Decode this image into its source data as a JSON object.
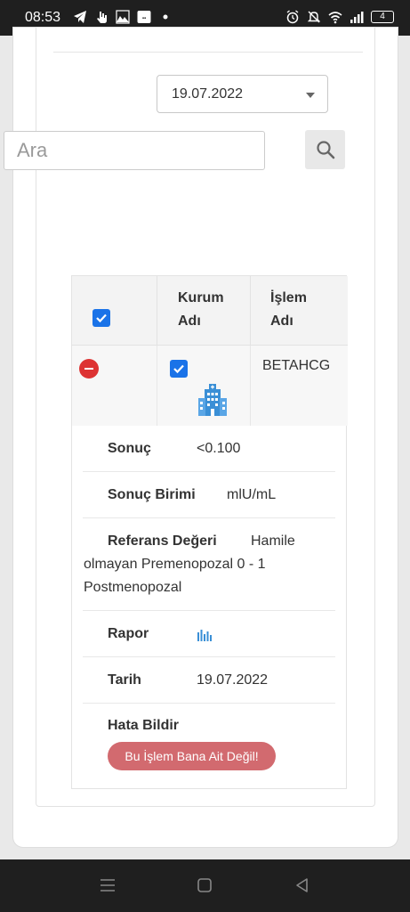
{
  "status_bar": {
    "time": "08:53",
    "battery": "4",
    "left_icons": [
      "telegram-icon",
      "hand-icon",
      "gallery-icon",
      "app-icon",
      "dot-icon"
    ],
    "right_icons": [
      "alarm-icon",
      "mute-icon",
      "wifi-icon",
      "signal-icon"
    ]
  },
  "filter": {
    "date_value": "19.07.2022",
    "search_placeholder": "Ara"
  },
  "table": {
    "headers": {
      "col2_line1": "Kurum",
      "col2_line2": "Adı",
      "col3_line1": "İşlem",
      "col3_line2": "Adı"
    },
    "row": {
      "islem_adi": "BETAHCG",
      "institution_icon": "hospital-building-icon"
    }
  },
  "details": {
    "sonuc_label": "Sonuç",
    "sonuc_value": "<0.100",
    "birim_label": "Sonuç Birimi",
    "birim_value": "mlU/mL",
    "referans_label": "Referans Değeri",
    "referans_value_line1": "Hamile",
    "referans_value_line2": "olmayan Premenopozal 0 - 1",
    "referans_value_line3": "Postmenopozal",
    "rapor_label": "Rapor",
    "rapor_icon": "bar-chart-icon",
    "tarih_label": "Tarih",
    "tarih_value": "19.07.2022",
    "hata_label": "Hata Bildir",
    "hata_button": "Bu İşlem Bana Ait Değil!"
  },
  "colors": {
    "checkbox": "#1a73e8",
    "remove": "#dd3333",
    "error_button": "#d26a6f",
    "icon_blue": "#3a8fd6"
  },
  "nav": [
    "menu-icon",
    "home-icon",
    "back-icon"
  ]
}
